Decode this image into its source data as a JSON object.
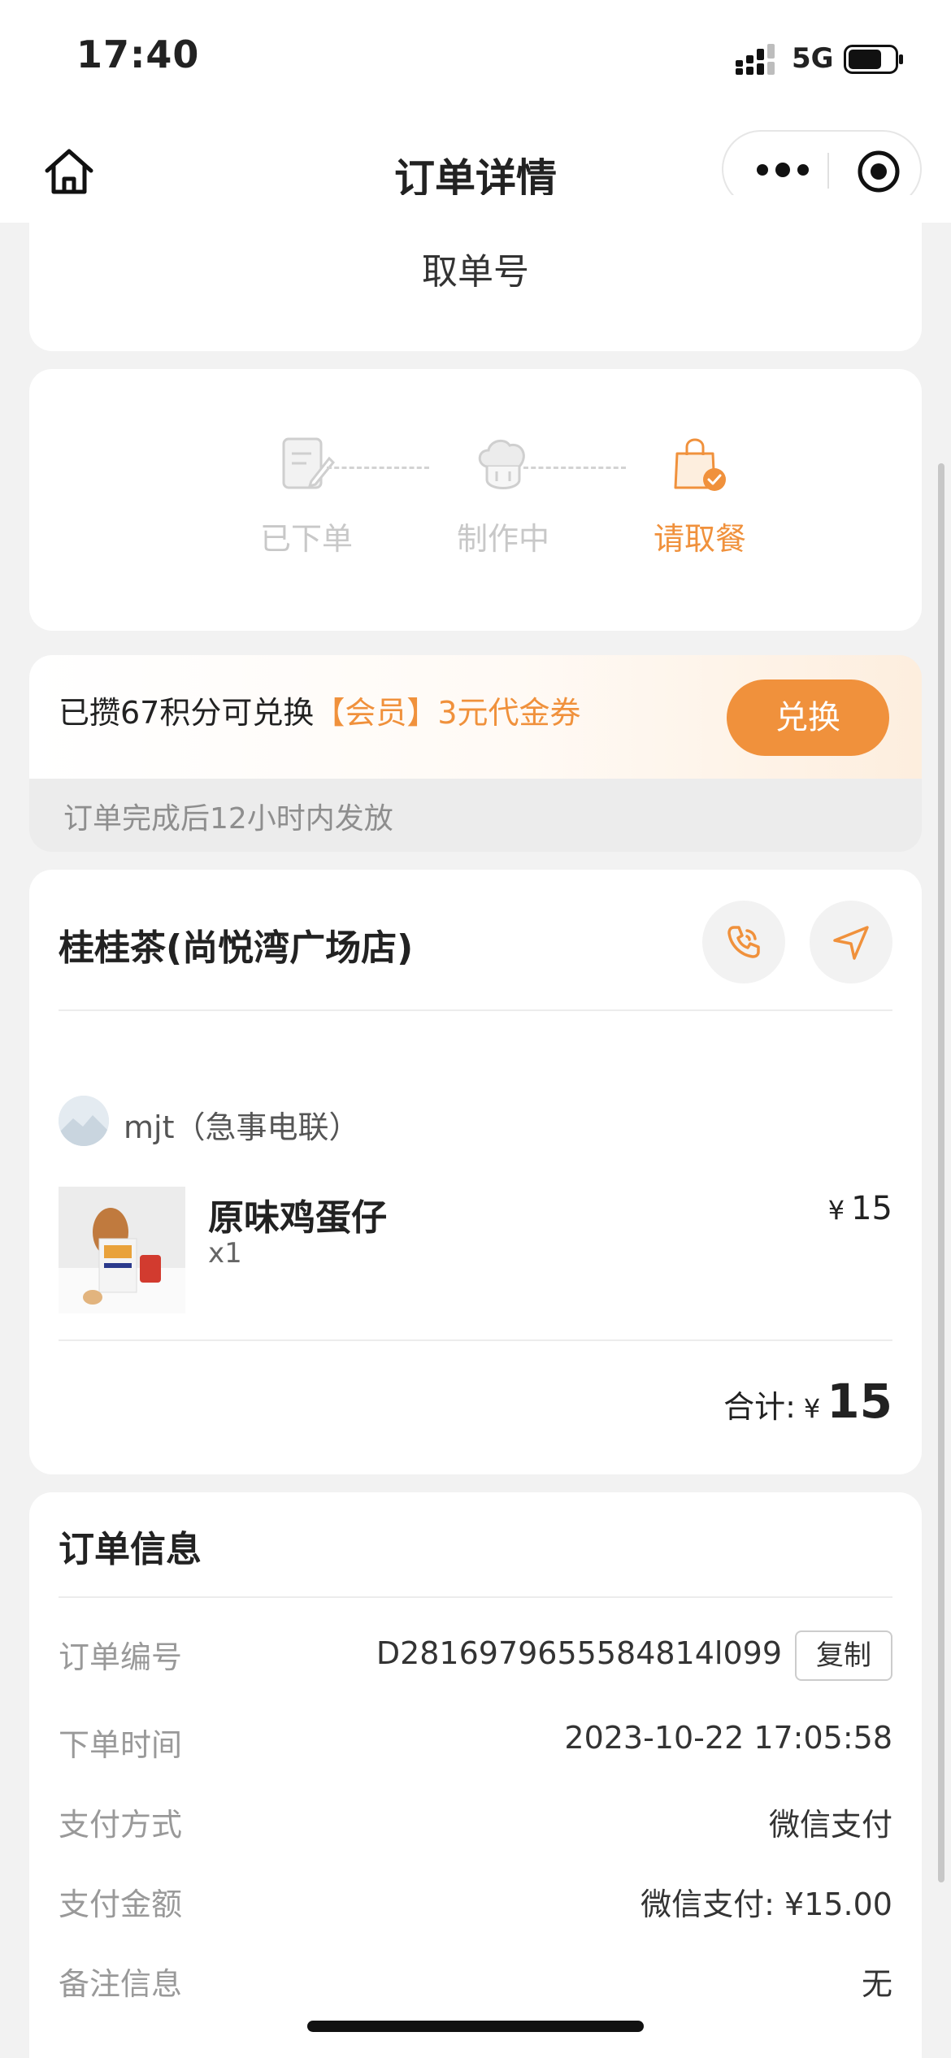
{
  "status_bar": {
    "time": "17:40",
    "network": "5G",
    "battery_level": 0.65
  },
  "nav": {
    "title": "订单详情",
    "home_icon": "home-icon",
    "more_icon": "more-icon",
    "target_icon": "target-icon"
  },
  "pickup": {
    "label": "取单号"
  },
  "progress": {
    "steps": [
      {
        "label": "已下单",
        "icon": "order-note-icon",
        "state": "done"
      },
      {
        "label": "制作中",
        "icon": "chef-hat-icon",
        "state": "done"
      },
      {
        "label": "请取餐",
        "icon": "shopping-bag-icon",
        "state": "active"
      }
    ],
    "active_color": "#f0913c"
  },
  "points": {
    "text_prefix": "已攒67积分可兑换",
    "text_highlight": "【会员】3元代金券",
    "button_label": "兑换",
    "note": "订单完成后12小时内发放"
  },
  "store": {
    "name": "桂桂茶(尚悦湾广场店)",
    "phone_icon": "phone-icon",
    "nav_icon": "navigation-icon",
    "user": "mjt（急事电联）",
    "items": [
      {
        "name": "原味鸡蛋仔",
        "qty": "x1",
        "currency": "¥",
        "price": "15"
      }
    ],
    "total_label": "合计:",
    "total_currency": "¥",
    "total_amount": "15"
  },
  "order_info": {
    "title": "订单信息",
    "copy_label": "复制",
    "rows": [
      {
        "label": "订单编号",
        "value": "D2816979655584814l099"
      },
      {
        "label": "下单时间",
        "value": "2023-10-22 17:05:58"
      },
      {
        "label": "支付方式",
        "value": "微信支付"
      },
      {
        "label": "支付金额",
        "value": "微信支付: ¥15.00"
      },
      {
        "label": "备注信息",
        "value": "无"
      }
    ]
  }
}
